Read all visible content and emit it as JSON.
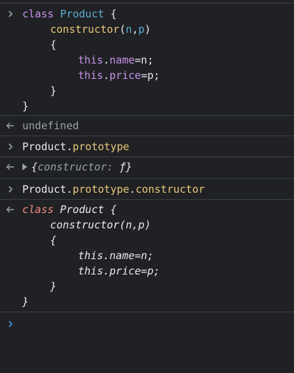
{
  "entry1": {
    "l1": {
      "kw": "class",
      "cls": "Product",
      "brace": "{"
    },
    "l2": {
      "fn": "constructor",
      "paren_open": "(",
      "a": "n",
      "comma": ",",
      "b": "p",
      "paren_close": ")"
    },
    "l3": {
      "brace": "{"
    },
    "l4": {
      "this": "this",
      "dot": ".",
      "prop": "name",
      "rest": "=n;"
    },
    "l5": {
      "this": "this",
      "dot": ".",
      "prop": "price",
      "rest": "=p;"
    },
    "l6": {
      "brace": "}"
    },
    "l7": {
      "brace": "}"
    }
  },
  "result1": {
    "text": "undefined"
  },
  "entry2": {
    "obj": "Product",
    "dot": ".",
    "prop": "prototype"
  },
  "result2": {
    "open": "{",
    "key": "constructor:",
    "val": "ƒ",
    "close": "}"
  },
  "entry3": {
    "obj": "Product",
    "dot1": ".",
    "prop1": "prototype",
    "dot2": ".",
    "prop2": "constructor"
  },
  "result3": {
    "l1": {
      "kw": "class",
      "rest": " Product {"
    },
    "l2": {
      "text": "constructor(n,p)"
    },
    "l3": {
      "text": "{"
    },
    "l4": {
      "text": "this.name=n;"
    },
    "l5": {
      "text": "this.price=p;"
    },
    "l6": {
      "text": "}"
    },
    "l7": {
      "text": "}"
    }
  },
  "prompt": {
    "value": ""
  },
  "colors": {
    "background": "#202124",
    "keyword": "#c792ea",
    "class_name": "#5db0d7",
    "function": "#e8c97a",
    "result_keyword": "#f28b82",
    "prompt": "#4a90e2"
  }
}
